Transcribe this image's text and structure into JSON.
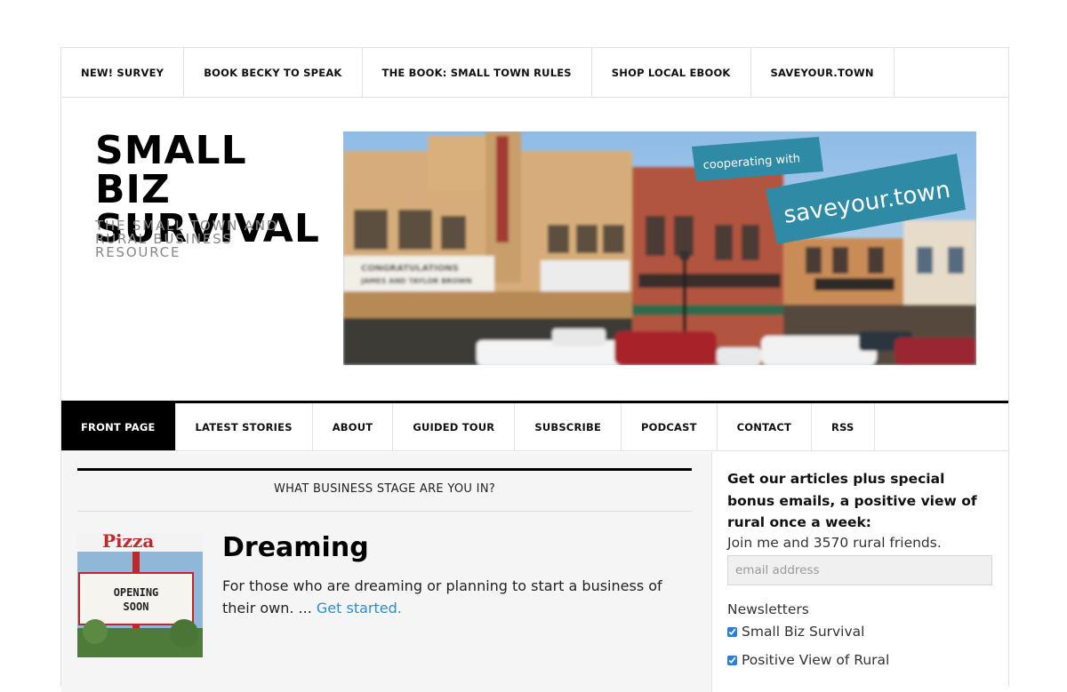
{
  "top_nav": [
    {
      "label": "NEW! SURVEY"
    },
    {
      "label": "BOOK BECKY TO SPEAK"
    },
    {
      "label": "THE BOOK: SMALL TOWN RULES"
    },
    {
      "label": "SHOP LOCAL EBOOK"
    },
    {
      "label": "SAVEYOUR.TOWN"
    }
  ],
  "header": {
    "title": "SMALL BIZ SURVIVAL",
    "tagline": "THE SMALL TOWN AND RURAL BUSINESS RESOURCE",
    "banner": {
      "ribbon_small": "cooperating with",
      "ribbon_large": "saveyour.town",
      "marquee_line1": "CONGRATULATIONS",
      "marquee_line2": "JAMES AND TAYLOR BROWN",
      "ribbon_color": "#2f8aa5"
    }
  },
  "main_nav": [
    {
      "label": "FRONT PAGE",
      "active": true
    },
    {
      "label": "LATEST STORIES"
    },
    {
      "label": "ABOUT"
    },
    {
      "label": "GUIDED TOUR"
    },
    {
      "label": "SUBSCRIBE"
    },
    {
      "label": "PODCAST"
    },
    {
      "label": "CONTACT"
    },
    {
      "label": "RSS"
    }
  ],
  "content": {
    "section_title": "WHAT BUSINESS STAGE ARE YOU IN?",
    "entry": {
      "title": "Dreaming",
      "text": "For those who are dreaming or planning to start a business of their own. ...",
      "link": "Get started.",
      "thumb_sign_top": "Pizza",
      "thumb_sign_line1": "OPENING",
      "thumb_sign_line2": "SOON"
    }
  },
  "sidebar": {
    "heading": "Get our articles plus special bonus emails, a positive view of rural once a week:",
    "subtext": "Join me and 3570 rural friends.",
    "email_placeholder": "email address",
    "newsletters_label": "Newsletters",
    "newsletters": [
      {
        "label": "Small Biz Survival",
        "checked": true
      },
      {
        "label": "Positive View of Rural",
        "checked": true
      }
    ]
  }
}
